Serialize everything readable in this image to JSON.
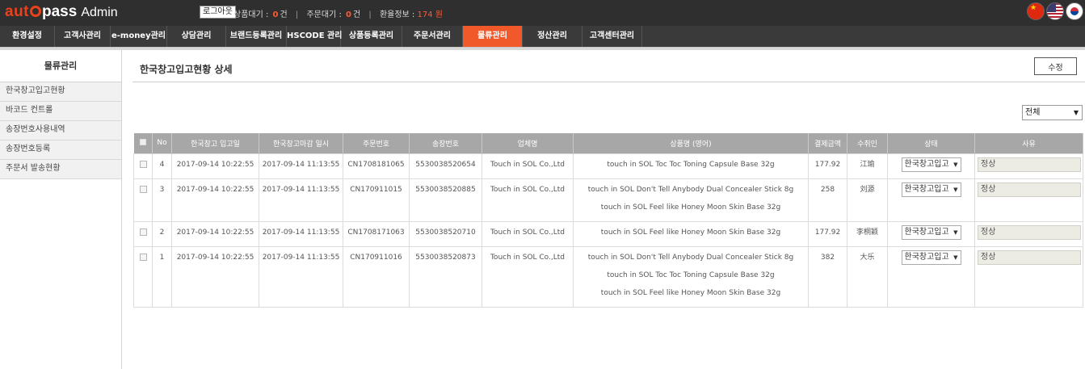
{
  "header": {
    "logo_auto": "aut",
    "logo_pass": "pass",
    "logo_admin": "Admin",
    "logout_label": "로그아웃",
    "pending_products_label": "상품대기 :",
    "pending_products_count": "0",
    "pending_products_unit": "건",
    "pending_orders_label": "주문대기 :",
    "pending_orders_count": "0",
    "pending_orders_unit": "건",
    "exchange_label": "환율정보 :",
    "exchange_value": "174 원",
    "flags": [
      "china-flag-icon",
      "usa-flag-icon",
      "korea-flag-icon"
    ]
  },
  "nav": {
    "items": [
      {
        "label": "환경설정"
      },
      {
        "label": "고객사관리"
      },
      {
        "label": "e-money관리"
      },
      {
        "label": "상담관리"
      },
      {
        "label": "브랜드등록관리"
      },
      {
        "label": "HSCODE 관리"
      },
      {
        "label": "상품등록관리"
      },
      {
        "label": "주문서관리"
      },
      {
        "label": "물류관리"
      },
      {
        "label": "정산관리"
      },
      {
        "label": "고객센터관리"
      }
    ],
    "active": "물류관리"
  },
  "sidebar": {
    "title": "물류관리",
    "items": [
      {
        "label": "한국창고입고현황"
      },
      {
        "label": "바코드 컨트롤"
      },
      {
        "label": "송장번호사용내역"
      },
      {
        "label": "송장번호등록"
      },
      {
        "label": "주문서 발송현황"
      }
    ]
  },
  "main": {
    "title": "한국창고입고현황 상세",
    "edit_label": "수정",
    "filter_value": "전체",
    "columns": [
      "No",
      "한국창고 입고일",
      "한국창고마감 일시",
      "주문번호",
      "송장번호",
      "업체명",
      "상품명 (영어)",
      "결제금액",
      "수취인",
      "상태",
      "사유"
    ],
    "rows": [
      {
        "no": "4",
        "in_date": "2017-09-14 10:22:55",
        "close_date": "2017-09-14 11:13:55",
        "order_no": "CN1708181065",
        "invoice": "5530038520654",
        "company": "Touch in SOL Co.,Ltd",
        "products": [
          "touch in SOL Toc Toc Toning Capsule Base 32g"
        ],
        "amount": "177.92",
        "recipient": "江瑜",
        "status": "한국창고입고",
        "reason": "정상"
      },
      {
        "no": "3",
        "in_date": "2017-09-14 10:22:55",
        "close_date": "2017-09-14 11:13:55",
        "order_no": "CN170911015",
        "invoice": "5530038520885",
        "company": "Touch in SOL Co.,Ltd",
        "products": [
          "touch in SOL Don't Tell Anybody Dual Concealer Stick 8g",
          "touch in SOL Feel like Honey Moon Skin Base 32g"
        ],
        "amount": "258",
        "recipient": "刘源",
        "status": "한국창고입고",
        "reason": "정상"
      },
      {
        "no": "2",
        "in_date": "2017-09-14 10:22:55",
        "close_date": "2017-09-14 11:13:55",
        "order_no": "CN1708171063",
        "invoice": "5530038520710",
        "company": "Touch in SOL Co.,Ltd",
        "products": [
          "touch in SOL Feel like Honey Moon Skin Base 32g"
        ],
        "amount": "177.92",
        "recipient": "李桐颖",
        "status": "한국창고입고",
        "reason": "정상"
      },
      {
        "no": "1",
        "in_date": "2017-09-14 10:22:55",
        "close_date": "2017-09-14 11:13:55",
        "order_no": "CN170911016",
        "invoice": "5530038520873",
        "company": "Touch in SOL Co.,Ltd",
        "products": [
          "touch in SOL Don't Tell Anybody Dual Concealer Stick 8g",
          "touch in SOL Toc Toc Toning Capsule Base 32g",
          "touch in SOL Feel like Honey Moon Skin Base 32g"
        ],
        "amount": "382",
        "recipient": "大乐",
        "status": "한국창고입고",
        "reason": "정상"
      }
    ]
  },
  "colors": {
    "brand": "#e8431c",
    "topbar": "#2f2f2f",
    "nav": "#3a3a3a",
    "nav_active": "#f2592a",
    "table_header": "#a7a7a7"
  }
}
